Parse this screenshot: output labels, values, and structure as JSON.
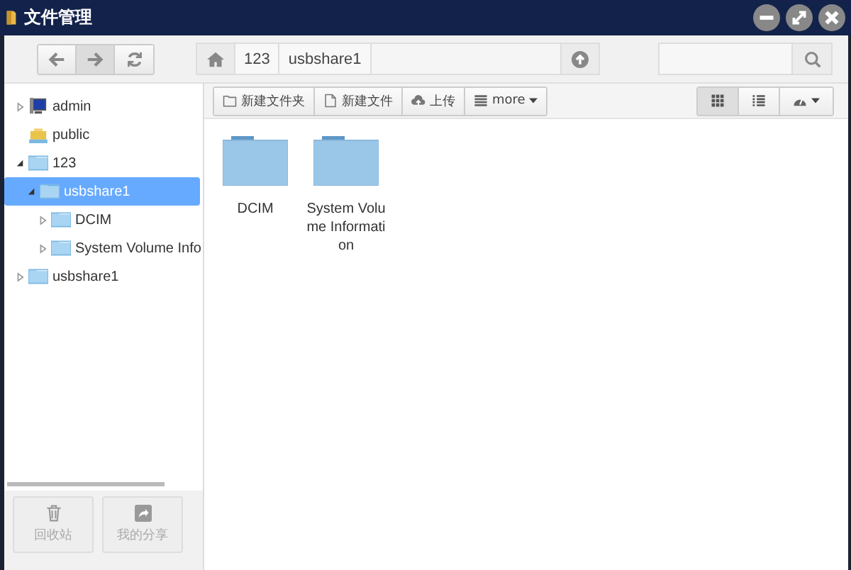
{
  "window": {
    "title": "文件管理"
  },
  "breadcrumb": [
    "123",
    "usbshare1"
  ],
  "toolbar": [
    "新建文件夹",
    "新建文件",
    "上传",
    "more"
  ],
  "view_buttons": [
    {
      "kind": "grid",
      "selected": true
    },
    {
      "kind": "list",
      "selected": false
    },
    {
      "kind": "gauge",
      "selected": false
    }
  ],
  "tree": [
    {
      "label": "admin",
      "kind": "computer",
      "expanded": false,
      "has_children": true,
      "selected": false
    },
    {
      "label": "public",
      "kind": "share",
      "has_children": false,
      "selected": false
    },
    {
      "label": "123",
      "kind": "folder",
      "expanded": true,
      "has_children": true,
      "selected": false,
      "children": [
        {
          "label": "usbshare1",
          "kind": "folder",
          "expanded": true,
          "has_children": true,
          "selected": true,
          "children": [
            {
              "label": "DCIM",
              "kind": "folder",
              "expanded": false,
              "has_children": true,
              "selected": false
            },
            {
              "label": "System Volume Info",
              "kind": "folder",
              "expanded": false,
              "has_children": true,
              "selected": false
            }
          ]
        }
      ]
    },
    {
      "label": "usbshare1",
      "kind": "folder",
      "expanded": false,
      "has_children": true,
      "selected": false
    }
  ],
  "files": [
    {
      "name": "DCIM"
    },
    {
      "name": "System Volume Information"
    }
  ],
  "bottom_buttons": [
    {
      "label": "回收站",
      "kind": "trash"
    },
    {
      "label": "我的分享",
      "kind": "share"
    }
  ]
}
